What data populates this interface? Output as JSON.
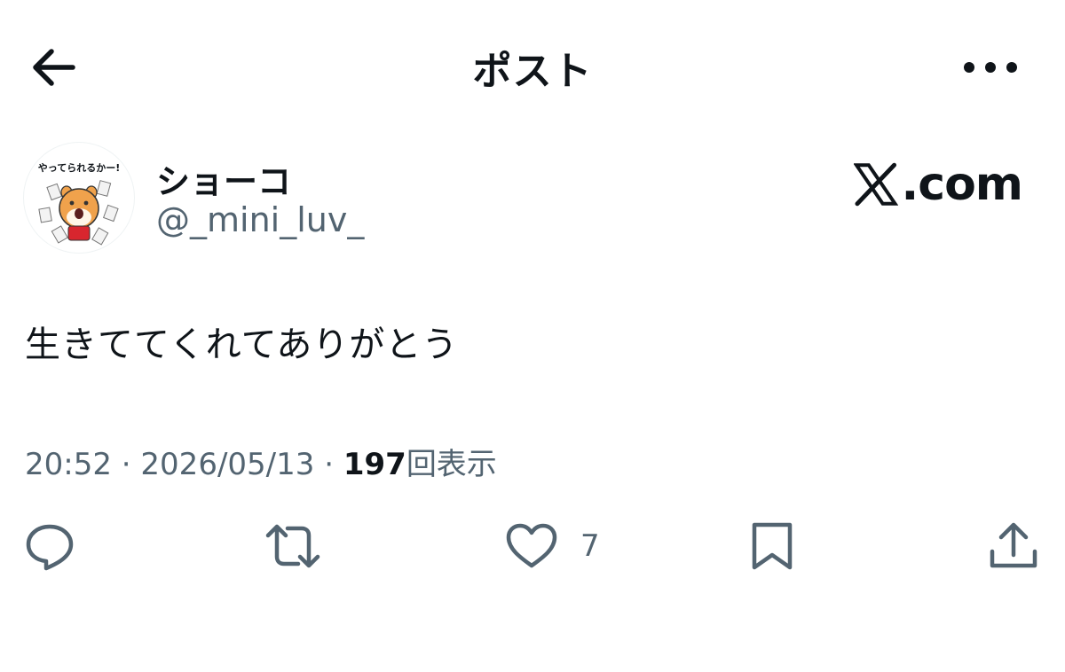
{
  "header": {
    "title": "ポスト",
    "back_icon": "arrow-left-icon",
    "more_icon": "more-horizontal-icon"
  },
  "author": {
    "display_name": "ショーコ",
    "handle": "@_mini_luv_",
    "avatar_text": "やってられるかー!"
  },
  "brand": {
    "text": ".com",
    "logo_icon": "x-logo-icon"
  },
  "post": {
    "text": "生きててくれてありがとう"
  },
  "meta": {
    "time": "20:52",
    "separator": " · ",
    "date": "2026/05/13",
    "views_count": "197",
    "views_label": "回表示"
  },
  "actions": {
    "reply_icon": "reply-icon",
    "repost_icon": "repost-icon",
    "like_icon": "heart-icon",
    "like_count": "7",
    "bookmark_icon": "bookmark-icon",
    "share_icon": "share-icon"
  },
  "colors": {
    "text_primary": "#0f1419",
    "text_secondary": "#536471",
    "icon": "#536471",
    "background": "#ffffff"
  }
}
